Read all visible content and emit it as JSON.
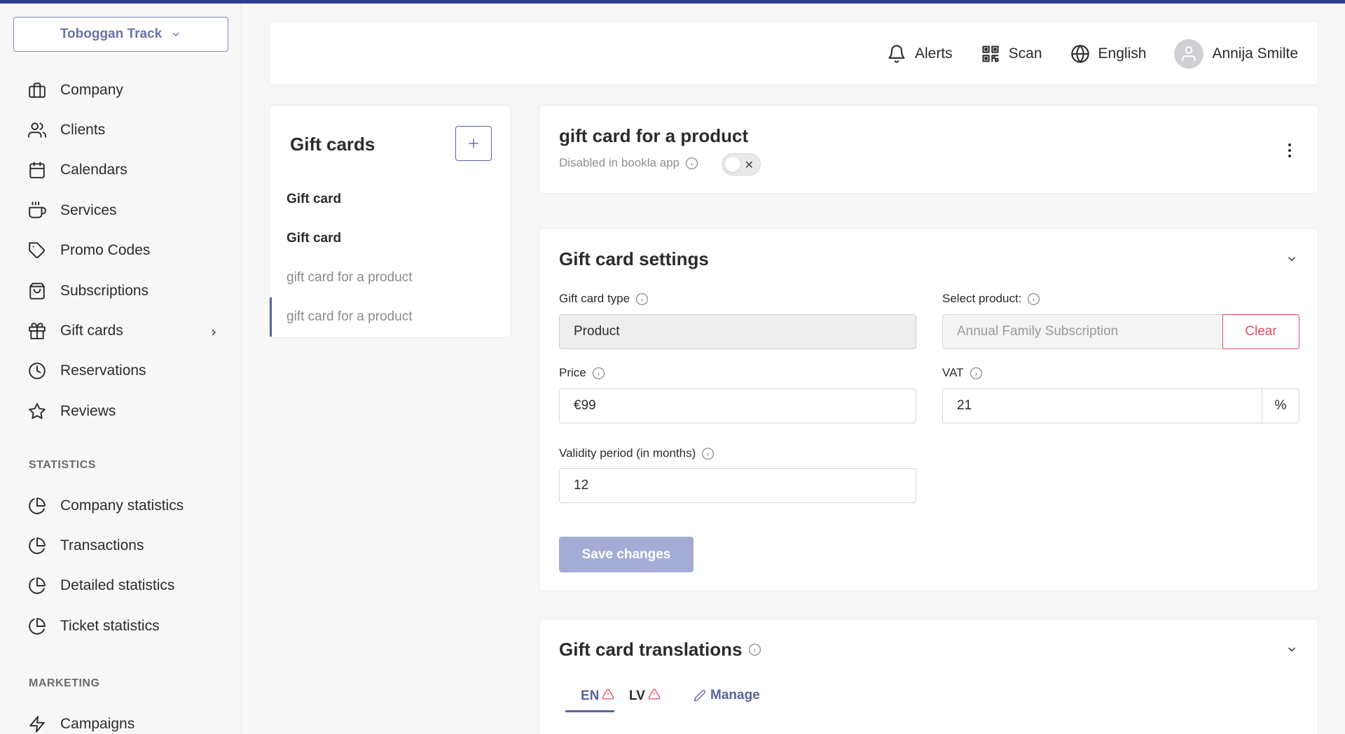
{
  "sidebar": {
    "company": "Toboggan Track",
    "items": [
      {
        "label": "Company",
        "icon": "briefcase-icon"
      },
      {
        "label": "Clients",
        "icon": "users-icon"
      },
      {
        "label": "Calendars",
        "icon": "calendar-icon"
      },
      {
        "label": "Services",
        "icon": "coffee-icon"
      },
      {
        "label": "Promo Codes",
        "icon": "tag-icon"
      },
      {
        "label": "Subscriptions",
        "icon": "shopping-bag-icon"
      },
      {
        "label": "Gift cards",
        "icon": "gift-icon"
      },
      {
        "label": "Reservations",
        "icon": "clock-icon"
      },
      {
        "label": "Reviews",
        "icon": "star-icon"
      }
    ],
    "statistics_label": "STATISTICS",
    "statistics": [
      {
        "label": "Company statistics",
        "icon": "pie-chart-icon"
      },
      {
        "label": "Transactions",
        "icon": "pie-chart-icon"
      },
      {
        "label": "Detailed statistics",
        "icon": "pie-chart-icon"
      },
      {
        "label": "Ticket statistics",
        "icon": "pie-chart-icon"
      }
    ],
    "marketing_label": "MARKETING",
    "marketing": [
      {
        "label": "Campaigns",
        "icon": "zap-icon"
      }
    ]
  },
  "header": {
    "alerts": "Alerts",
    "scan": "Scan",
    "language": "English",
    "user": "Annija Smilte"
  },
  "gift_list": {
    "title": "Gift cards",
    "items": [
      "Gift card",
      "Gift card",
      "gift card for a product",
      "gift card for a product"
    ]
  },
  "detail": {
    "title": "gift card for a product",
    "status": "Disabled in bookla app"
  },
  "settings": {
    "title": "Gift card settings",
    "type_label": "Gift card type",
    "type_value": "Product",
    "product_label": "Select product:",
    "product_value": "Annual Family Subscription",
    "clear_label": "Clear",
    "price_label": "Price",
    "price_value": "€99",
    "vat_label": "VAT",
    "vat_value": "21",
    "vat_suffix": "%",
    "validity_label": "Validity period (in months)",
    "validity_value": "12",
    "save_label": "Save changes"
  },
  "translations": {
    "title": "Gift card translations",
    "tab_en": "EN",
    "tab_lv": "LV",
    "manage": "Manage"
  },
  "colors": {
    "accent": "#5a649e",
    "danger": "#e04e61",
    "topbar": "#2f3b8f"
  }
}
